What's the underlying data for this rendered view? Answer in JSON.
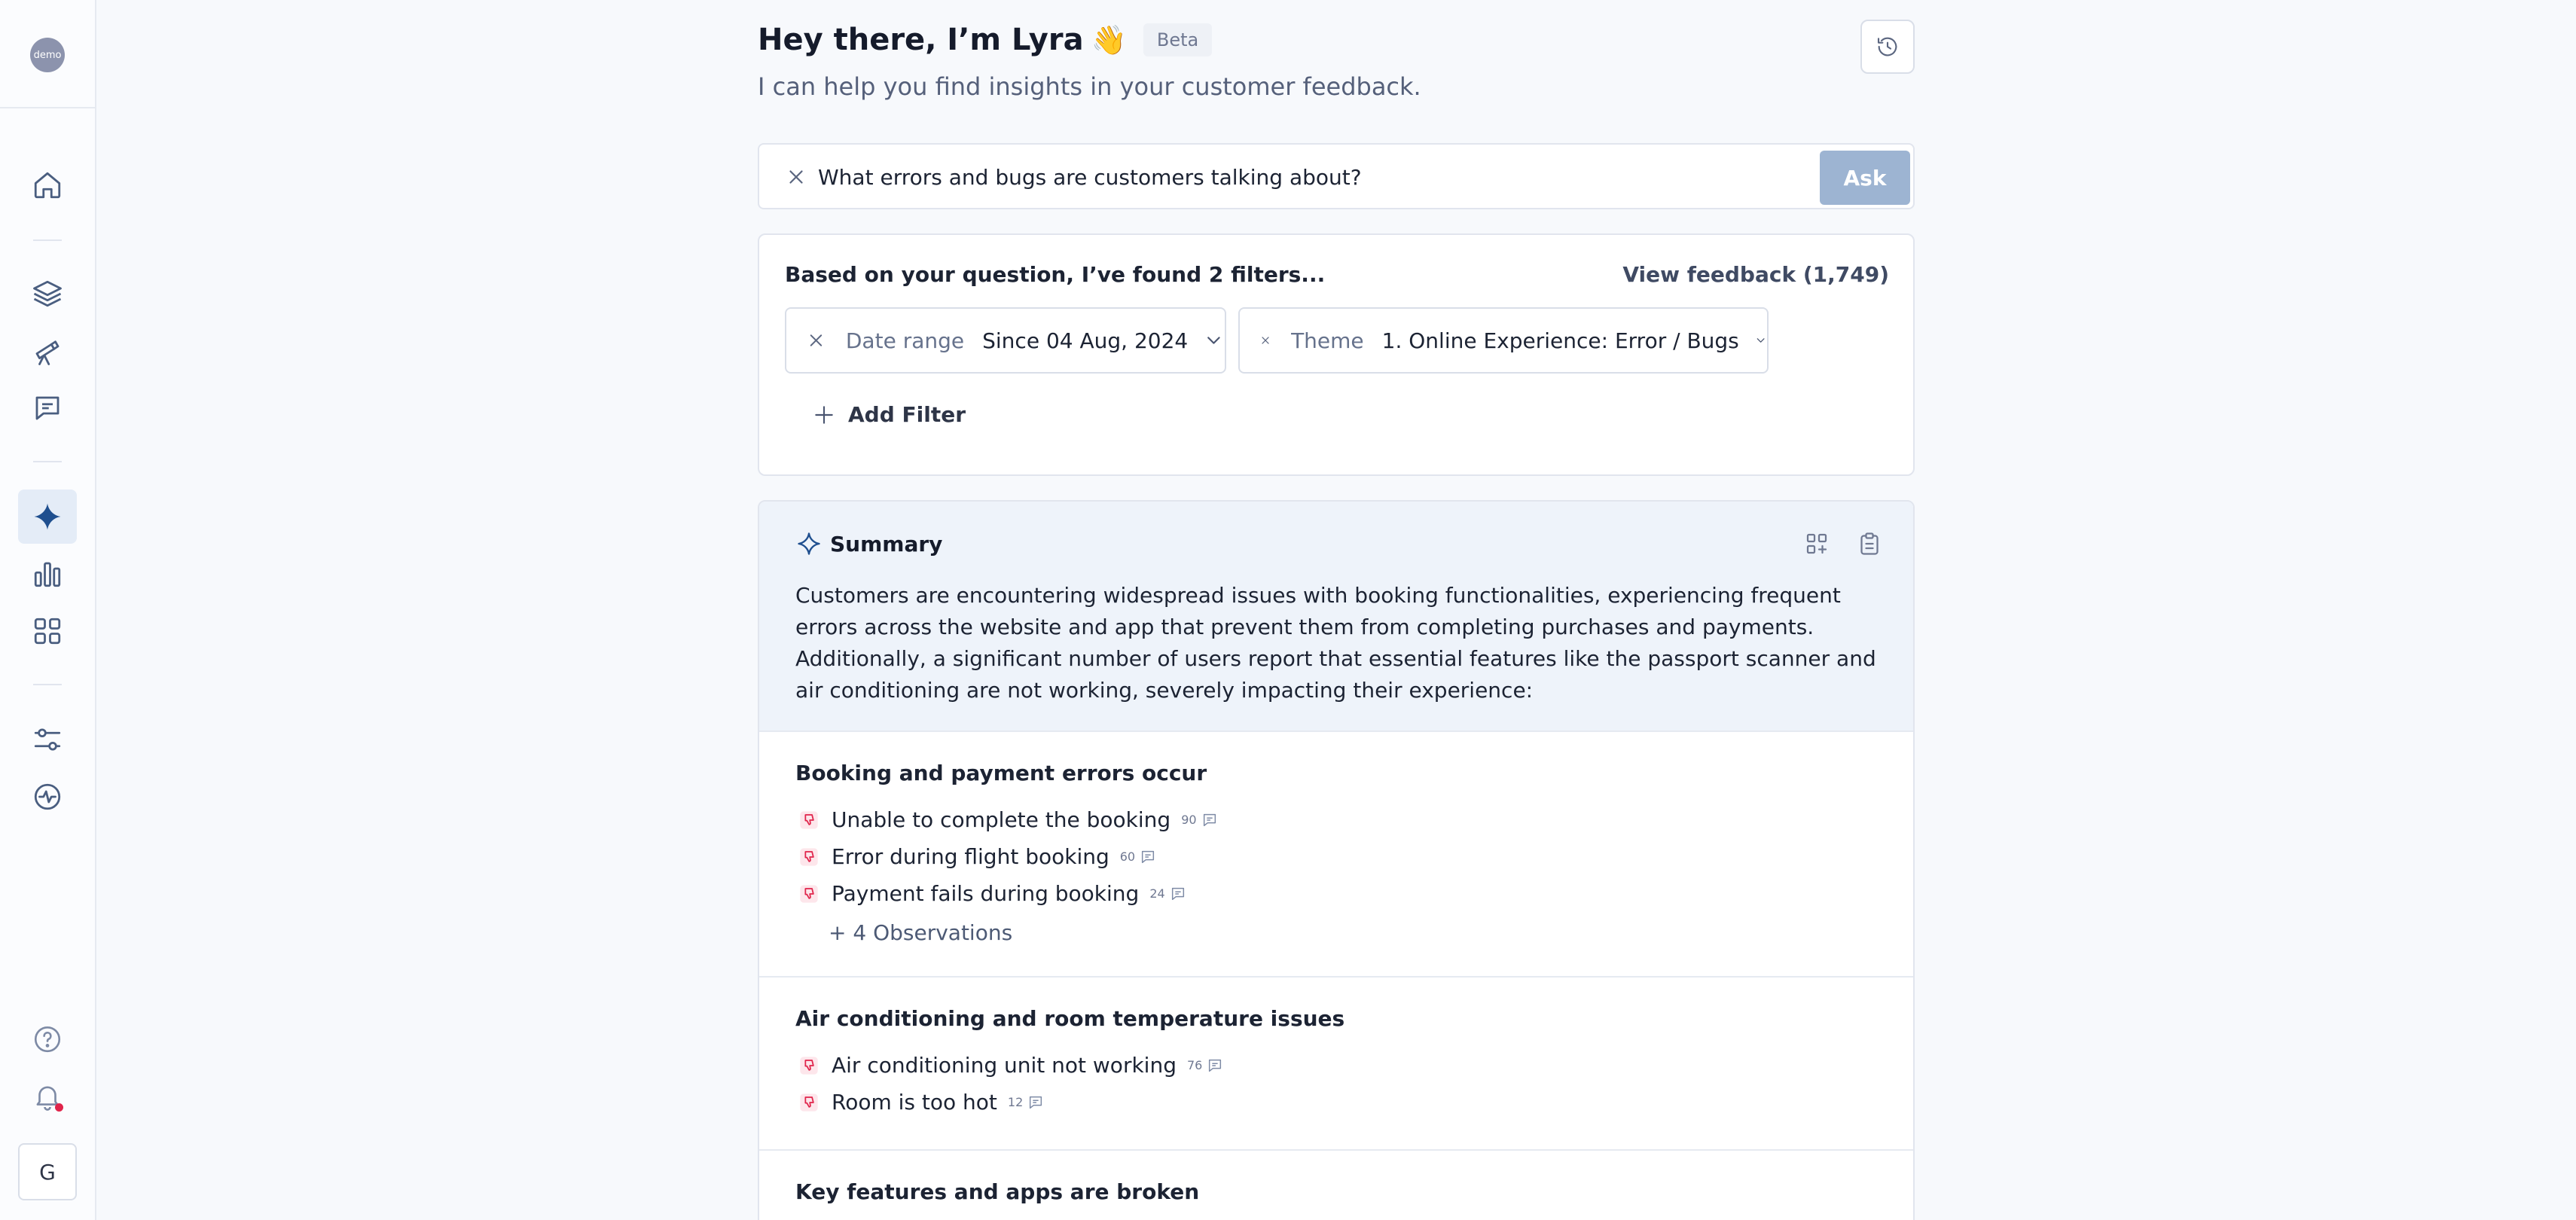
{
  "sidebar": {
    "logo_text": "demo",
    "user_initial": "G",
    "nav": [
      {
        "icon": "home-icon",
        "name": "home"
      },
      {
        "icon": "layers-icon",
        "name": "layers"
      },
      {
        "icon": "telescope-icon",
        "name": "discover"
      },
      {
        "icon": "message-icon",
        "name": "feedback"
      },
      {
        "icon": "sparkle-icon",
        "name": "lyra",
        "active": true
      },
      {
        "icon": "bar-chart-icon",
        "name": "analytics"
      },
      {
        "icon": "grid-icon",
        "name": "dashboards"
      },
      {
        "icon": "sliders-icon",
        "name": "settings"
      },
      {
        "icon": "pulse-icon",
        "name": "activity"
      },
      {
        "icon": "help-icon",
        "name": "help"
      },
      {
        "icon": "bell-icon",
        "name": "notifications"
      }
    ]
  },
  "header": {
    "title": "Hey there, I’m Lyra",
    "emoji": "👋",
    "badge": "Beta",
    "subtitle": "I can help you find insights in your customer feedback."
  },
  "ask": {
    "value": "What errors and bugs are customers talking about?",
    "button_label": "Ask"
  },
  "filters": {
    "heading": "Based on your question, I’ve found 2 filters...",
    "view_feedback": "View feedback (1,749)",
    "date_label": "Date range",
    "date_value": "Since 04 Aug, 2024",
    "theme_label": "Theme",
    "theme_value": "1. Online Experience: Error / Bugs",
    "add_filter": "Add Filter"
  },
  "summary": {
    "title": "Summary",
    "text": "Customers are encountering widespread issues with booking functionalities, experiencing frequent errors across the website and app that prevent them from completing purchases and payments. Additionally, a significant number of users report that essential features like the passport scanner and air conditioning are not working, severely impacting their experience:",
    "sections": [
      {
        "title": "Booking and payment errors occur",
        "items": [
          {
            "label": "Unable to complete the booking",
            "count": "90"
          },
          {
            "label": "Error during flight booking",
            "count": "60"
          },
          {
            "label": "Payment fails during booking",
            "count": "24"
          }
        ],
        "more": "+ 4 Observations"
      },
      {
        "title": "Air conditioning and room temperature issues",
        "items": [
          {
            "label": "Air conditioning unit not working",
            "count": "76"
          },
          {
            "label": "Room is too hot",
            "count": "12"
          }
        ]
      },
      {
        "title": "Key features and apps are broken",
        "items": []
      }
    ]
  },
  "colors": {
    "accent": "#1f4f8f",
    "ask_button": "#9db4d2",
    "summary_bg": "#eef3fa",
    "thumb_down": "#e0244b",
    "notification_dot": "#e0244b"
  }
}
